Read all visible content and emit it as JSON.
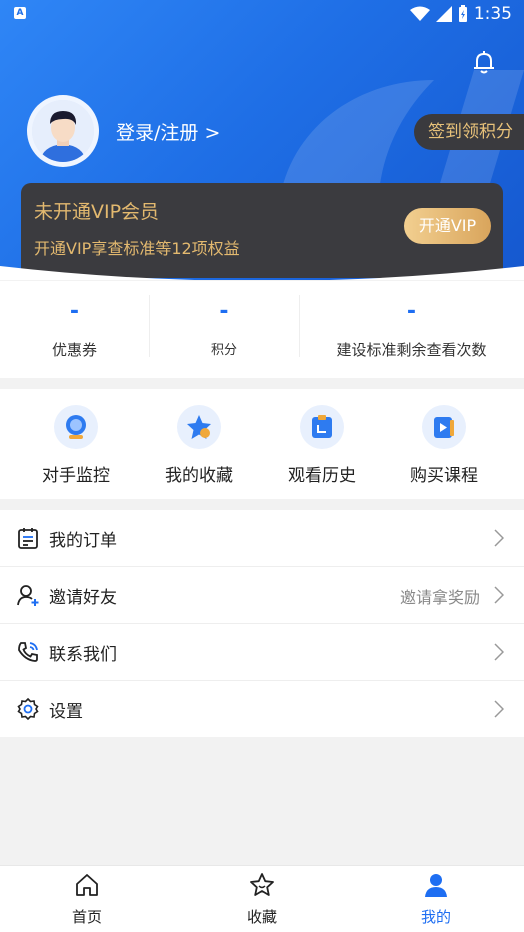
{
  "status_bar": {
    "time": "1:35",
    "app_indicator": "A"
  },
  "header": {
    "login_label": "登录/注册 >",
    "checkin_label": "签到领积分"
  },
  "vip": {
    "title": "未开通VIP会员",
    "subtitle": "开通VIP享查标准等12项权益",
    "button_label": "开通VIP"
  },
  "stats": [
    {
      "value": "-",
      "label": "优惠券"
    },
    {
      "value": "-",
      "label": "积分"
    },
    {
      "value": "-",
      "label": "建设标准剩余查看次数"
    }
  ],
  "shortcuts": [
    {
      "label": "对手监控",
      "icon": "monitor-icon"
    },
    {
      "label": "我的收藏",
      "icon": "star-icon"
    },
    {
      "label": "观看历史",
      "icon": "history-icon"
    },
    {
      "label": "购买课程",
      "icon": "course-icon"
    }
  ],
  "menu": [
    {
      "label": "我的订单",
      "icon": "order-icon",
      "extra": ""
    },
    {
      "label": "邀请好友",
      "icon": "invite-icon",
      "extra": "邀请拿奖励"
    },
    {
      "label": "联系我们",
      "icon": "phone-icon",
      "extra": ""
    },
    {
      "label": "设置",
      "icon": "settings-icon",
      "extra": ""
    }
  ],
  "tabs": [
    {
      "label": "首页",
      "icon": "home-icon",
      "active": false
    },
    {
      "label": "收藏",
      "icon": "star-icon",
      "active": false
    },
    {
      "label": "我的",
      "icon": "profile-icon",
      "active": true
    }
  ],
  "colors": {
    "primary": "#1e6ef2",
    "vip_gold": "#e3b96f",
    "vip_bg": "#3b3b3f"
  }
}
